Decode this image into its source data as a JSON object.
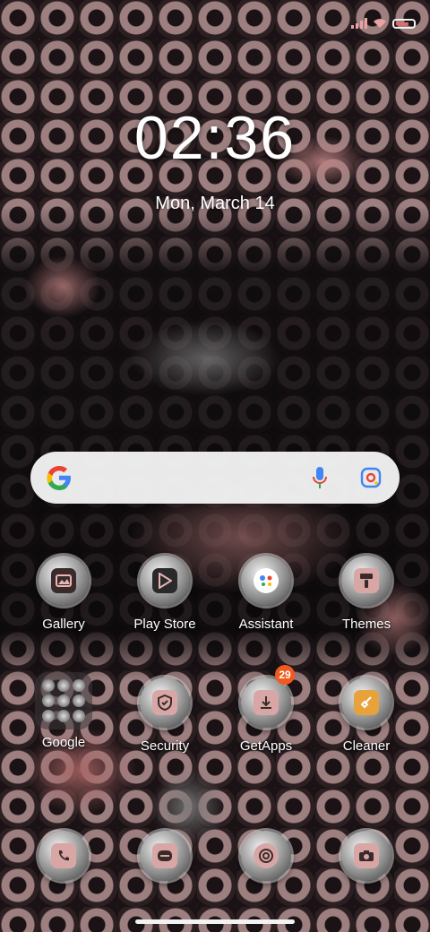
{
  "lockscreen": {
    "time": "02:36",
    "date": "Mon, March 14"
  },
  "statusbar": {
    "icons": [
      "signal-icon",
      "wifi-icon",
      "battery-icon"
    ]
  },
  "search": {
    "logo": "google-g-icon",
    "voice": "mic-icon",
    "lens": "google-lens-icon"
  },
  "apps": {
    "row1": [
      {
        "label": "Gallery",
        "icon": "gallery-icon"
      },
      {
        "label": "Play Store",
        "icon": "play-store-icon"
      },
      {
        "label": "Assistant",
        "icon": "assistant-icon"
      },
      {
        "label": "Themes",
        "icon": "themes-icon"
      }
    ],
    "row2": [
      {
        "label": "Google",
        "icon": "folder-icon"
      },
      {
        "label": "Security",
        "icon": "security-icon"
      },
      {
        "label": "GetApps",
        "icon": "getapps-icon",
        "badge": "29"
      },
      {
        "label": "Cleaner",
        "icon": "cleaner-icon"
      }
    ],
    "dock": [
      {
        "icon": "phone-icon"
      },
      {
        "icon": "messages-icon"
      },
      {
        "icon": "chrome-icon"
      },
      {
        "icon": "camera-icon"
      }
    ]
  },
  "colors": {
    "accent": "#e9a3a3",
    "badge": "#f05a1e"
  }
}
